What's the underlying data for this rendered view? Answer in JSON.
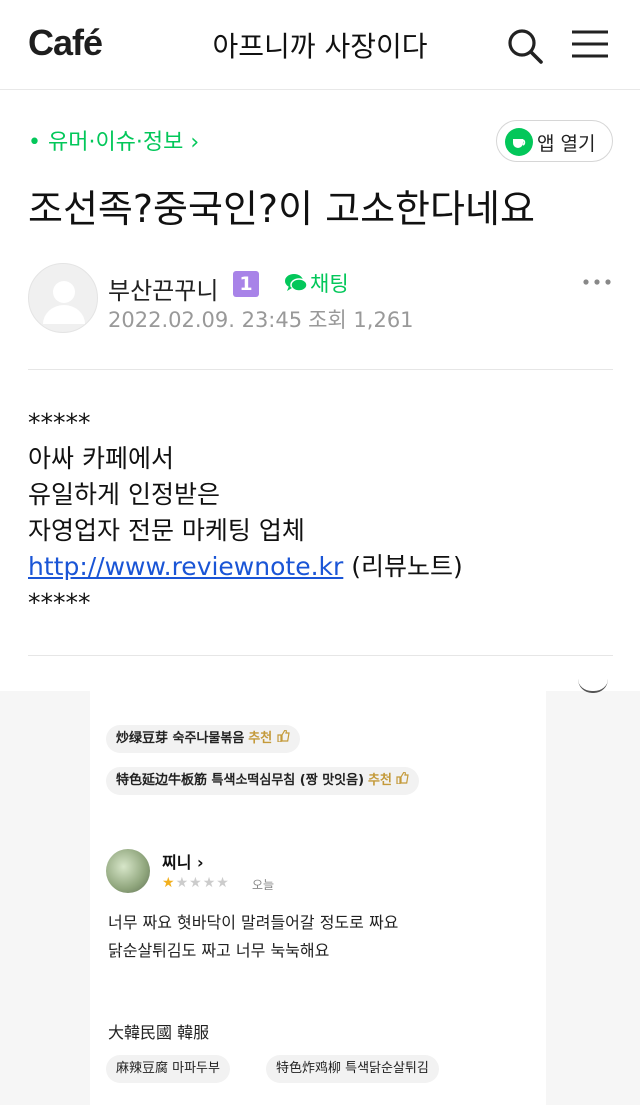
{
  "header": {
    "logo": "Café",
    "cafe_name": "아프니까 사장이다"
  },
  "article": {
    "board": "• 유머·이슈·정보 ›",
    "app_open_label": "앱 열기",
    "title": "조선족?중국인?이 고소한다네요",
    "author": "부산끈꾸니",
    "level": "1",
    "chat_label": "채팅",
    "date": "2022.02.09. 23:45",
    "views": "조회 1,261"
  },
  "body": {
    "line1": "*****",
    "line2": "아싸 카페에서",
    "line3": "유일하게 인정받은",
    "line4": "자영업자 전문 마케팅 업체",
    "link": "http://www.reviewnote.kr",
    "link_suffix": " (리뷰노트)",
    "line6": "*****"
  },
  "embed": {
    "chip1_name": "炒绿豆芽 숙주나물볶음",
    "chip1_rec": "추천",
    "chip2_name": "特色延边牛板筋 특색소떡심무침 (짱 맛잇음)",
    "chip2_rec": "추천",
    "reviewer": "찌니 ›",
    "rating": 1,
    "rating_max": 5,
    "review_date": "오늘",
    "review_line1": "너무 짜요 혓바닥이 말려들어갈 정도로 짜요",
    "review_line2": "닭순살튀김도 짜고 너무 눅눅해요",
    "tagline": "大韓民國 韓服",
    "chip3": "麻辣豆腐 마파두부",
    "chip4": "特色炸鸡柳 특색닭순살튀김"
  },
  "colors": {
    "accent_green": "#03c75a",
    "link_blue": "#1a55d6",
    "level_purple": "#a883e8",
    "star_gold": "#f2b01e"
  },
  "icons": [
    "search-icon",
    "menu-icon",
    "cafe-app-icon",
    "chat-icon",
    "more-icon",
    "thumbs-up-icon",
    "avatar-placeholder-icon"
  ]
}
